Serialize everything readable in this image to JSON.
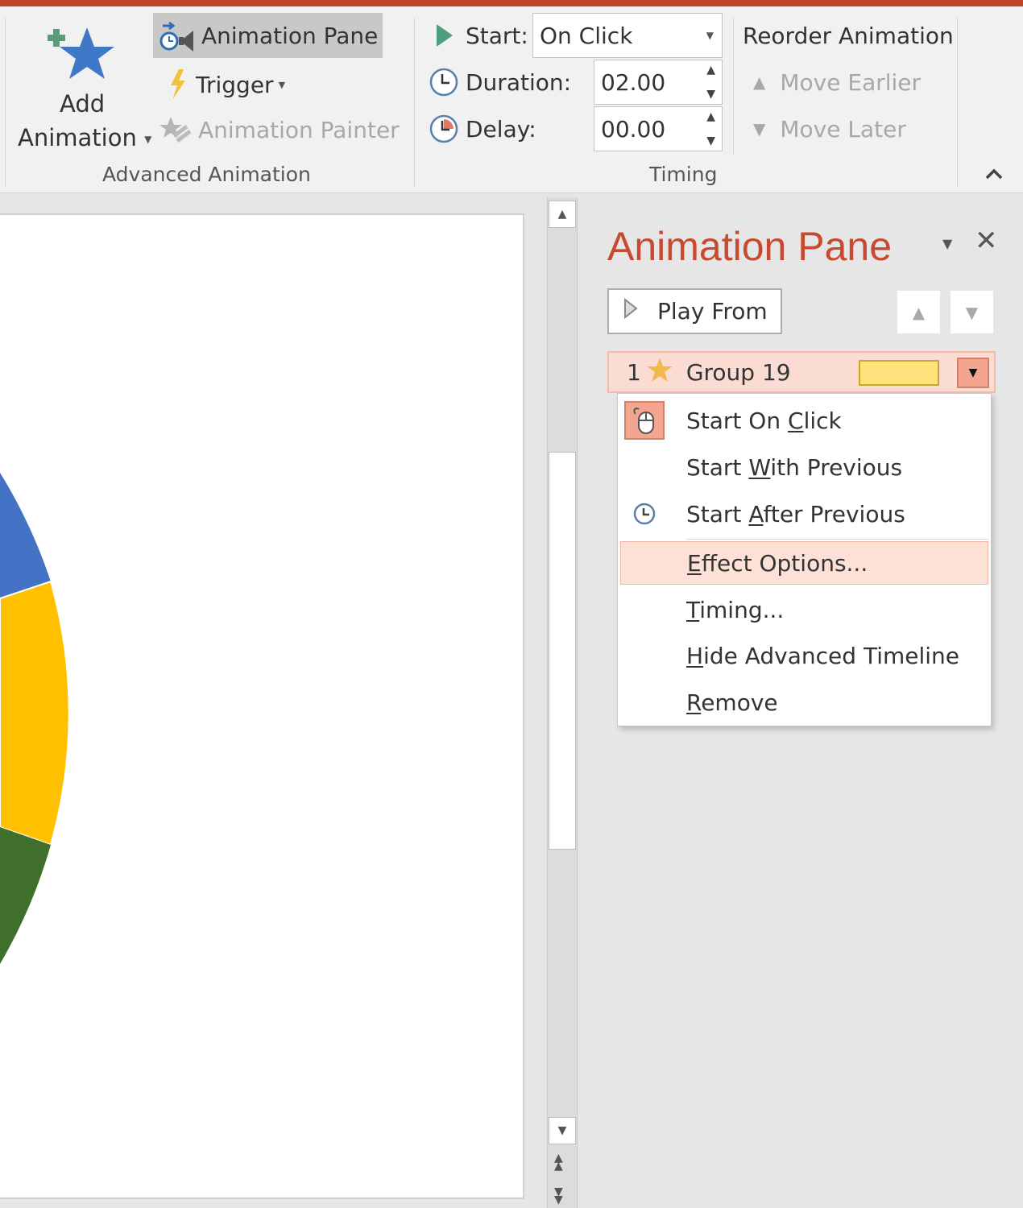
{
  "ribbon": {
    "advanced_animation": {
      "group_label": "Advanced Animation",
      "add_animation_line1": "Add",
      "add_animation_line2": "Animation",
      "animation_pane": "Animation Pane",
      "trigger": "Trigger",
      "animation_painter": "Animation Painter"
    },
    "timing": {
      "group_label": "Timing",
      "start_label": "Start:",
      "start_value": "On Click",
      "duration_label": "Duration:",
      "duration_value": "02.00",
      "delay_label": "Delay:",
      "delay_value": "00.00"
    },
    "reorder": {
      "title": "Reorder Animation",
      "move_earlier": "Move Earlier",
      "move_later": "Move Later"
    }
  },
  "pane": {
    "title": "Animation Pane",
    "play_from": "Play From",
    "items": [
      {
        "number": "1",
        "name": "Group 19"
      }
    ]
  },
  "context_menu": {
    "items": [
      {
        "pre": "Start On ",
        "key": "C",
        "post": "lick",
        "icon": "mouse-click-icon",
        "checked": true
      },
      {
        "pre": "Start ",
        "key": "W",
        "post": "ith Previous",
        "icon": "",
        "checked": false
      },
      {
        "pre": "Start ",
        "key": "A",
        "post": "fter Previous",
        "icon": "clock-icon",
        "checked": false
      },
      {
        "pre": "",
        "key": "E",
        "post": "ffect Options...",
        "icon": "",
        "highlighted": true
      },
      {
        "pre": "",
        "key": "T",
        "post": "iming...",
        "icon": ""
      },
      {
        "pre": "",
        "key": "H",
        "post": "ide Advanced Timeline",
        "icon": ""
      },
      {
        "pre": "",
        "key": "R",
        "post": "emove",
        "icon": ""
      }
    ]
  },
  "colors": {
    "accent": "#c74a30",
    "chart_blue": "#4472c4",
    "chart_yellow": "#ffc000",
    "chart_green": "#3f6f2b",
    "timebar": "#ffe27a"
  }
}
